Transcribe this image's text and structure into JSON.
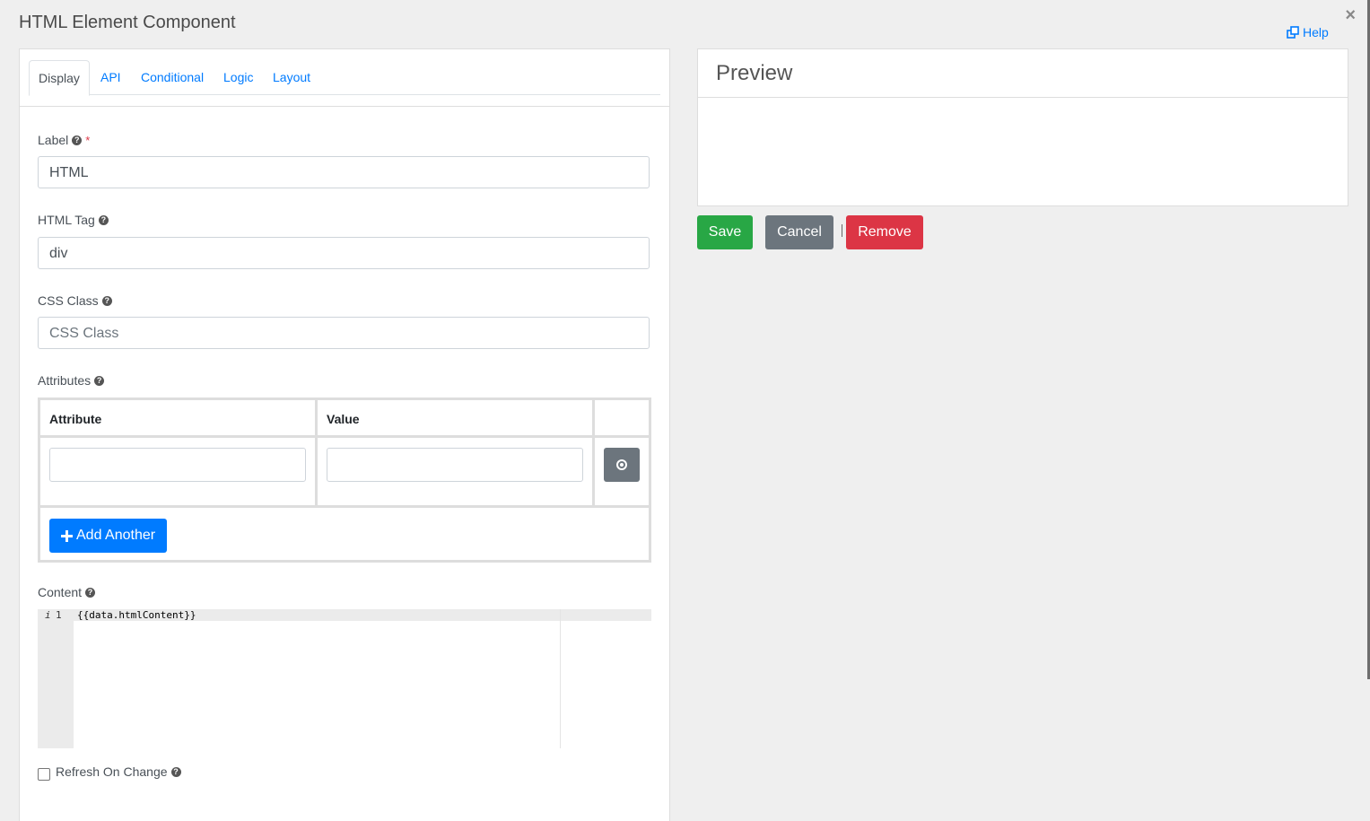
{
  "dialog": {
    "title": "HTML Element Component",
    "close_glyph": "×",
    "help_label": "Help"
  },
  "tabs": [
    {
      "label": "Display"
    },
    {
      "label": "API"
    },
    {
      "label": "Conditional"
    },
    {
      "label": "Logic"
    },
    {
      "label": "Layout"
    }
  ],
  "form": {
    "label_label": "Label",
    "label_required": "*",
    "label_value": "HTML",
    "html_tag_label": "HTML Tag",
    "html_tag_value": "div",
    "css_class_label": "CSS Class",
    "css_class_placeholder": "CSS Class",
    "attributes_label": "Attributes",
    "attr_col_attribute": "Attribute",
    "attr_col_value": "Value",
    "add_another_label": "Add Another",
    "content_label": "Content",
    "content_line_number": "1",
    "content_code": "{{data.htmlContent}}",
    "refresh_label": "Refresh On Change",
    "refresh_checked": false
  },
  "preview": {
    "title": "Preview"
  },
  "actions": {
    "save": "Save",
    "cancel": "Cancel",
    "remove": "Remove"
  },
  "colors": {
    "primary": "#007bff",
    "success": "#28a745",
    "secondary": "#6c757d",
    "danger": "#dc3545"
  },
  "icons": [
    "help-icon",
    "close-icon",
    "question-circle-icon",
    "remove-row-icon",
    "plus-icon"
  ]
}
